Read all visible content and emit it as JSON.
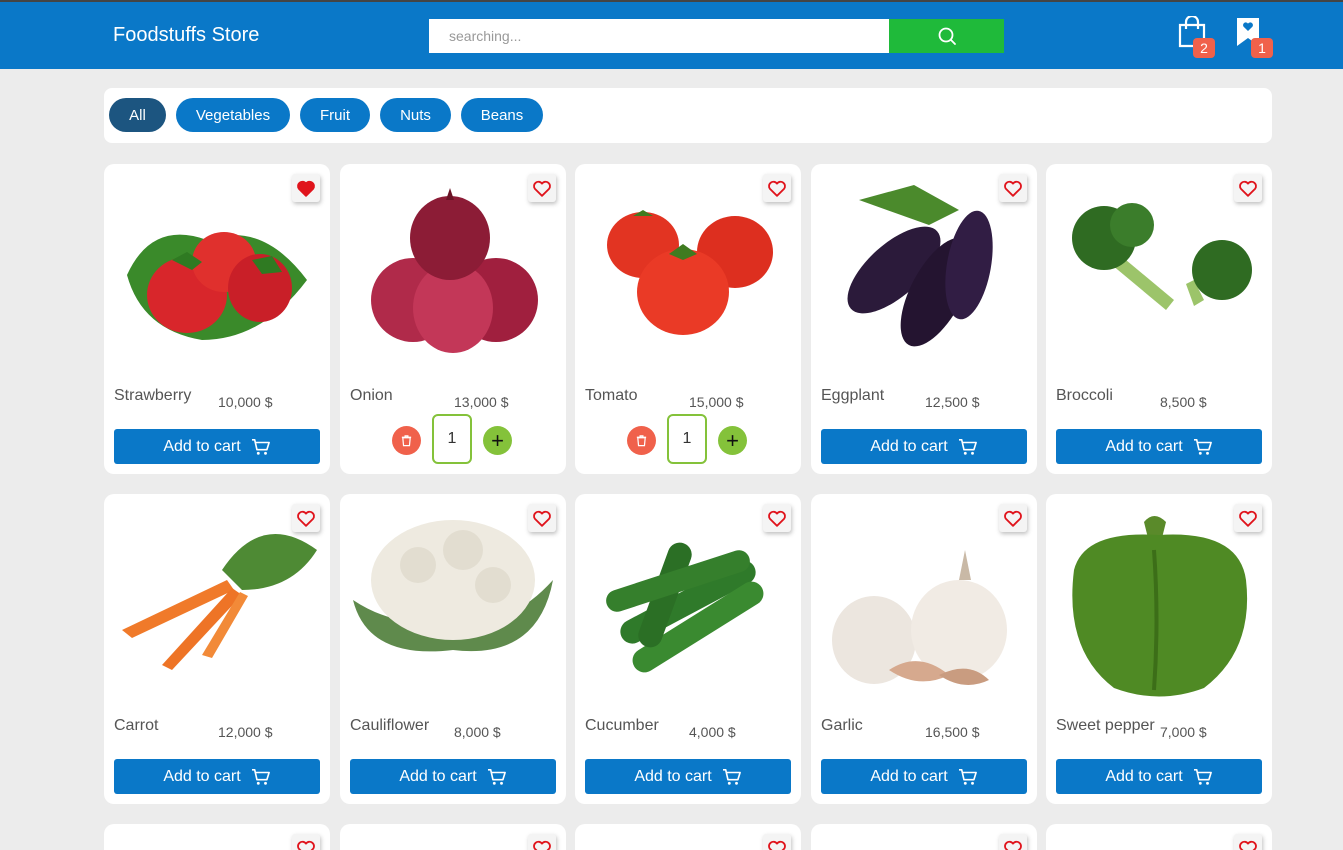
{
  "header": {
    "brand": "Foodstuffs Store",
    "search_placeholder": "searching...",
    "search_value": "",
    "search_icon": "search-icon",
    "cart_count": "2",
    "favorites_count": "1",
    "bar_color": "#0a78c8",
    "search_button_color": "#1fba3a"
  },
  "filters": [
    {
      "label": "All",
      "active": true
    },
    {
      "label": "Vegetables",
      "active": false
    },
    {
      "label": "Fruit",
      "active": false
    },
    {
      "label": "Nuts",
      "active": false
    },
    {
      "label": "Beans",
      "active": false
    }
  ],
  "add_to_cart_label": "Add to cart",
  "products": [
    {
      "name": "Strawberry",
      "price": "10,000 $",
      "favorite": true,
      "in_cart": false
    },
    {
      "name": "Onion",
      "price": "13,000 $",
      "favorite": false,
      "in_cart": true,
      "quantity": "1"
    },
    {
      "name": "Tomato",
      "price": "15,000 $",
      "favorite": false,
      "in_cart": true,
      "quantity": "1"
    },
    {
      "name": "Eggplant",
      "price": "12,500 $",
      "favorite": false,
      "in_cart": false
    },
    {
      "name": "Broccoli",
      "price": "8,500 $",
      "favorite": false,
      "in_cart": false
    },
    {
      "name": "Carrot",
      "price": "12,000 $",
      "favorite": false,
      "in_cart": false
    },
    {
      "name": "Cauliflower",
      "price": "8,000 $",
      "favorite": false,
      "in_cart": false
    },
    {
      "name": "Cucumber",
      "price": "4,000 $",
      "favorite": false,
      "in_cart": false
    },
    {
      "name": "Garlic",
      "price": "16,500 $",
      "favorite": false,
      "in_cart": false
    },
    {
      "name": "Sweet pepper",
      "price": "7,000 $",
      "favorite": false,
      "in_cart": false
    }
  ]
}
